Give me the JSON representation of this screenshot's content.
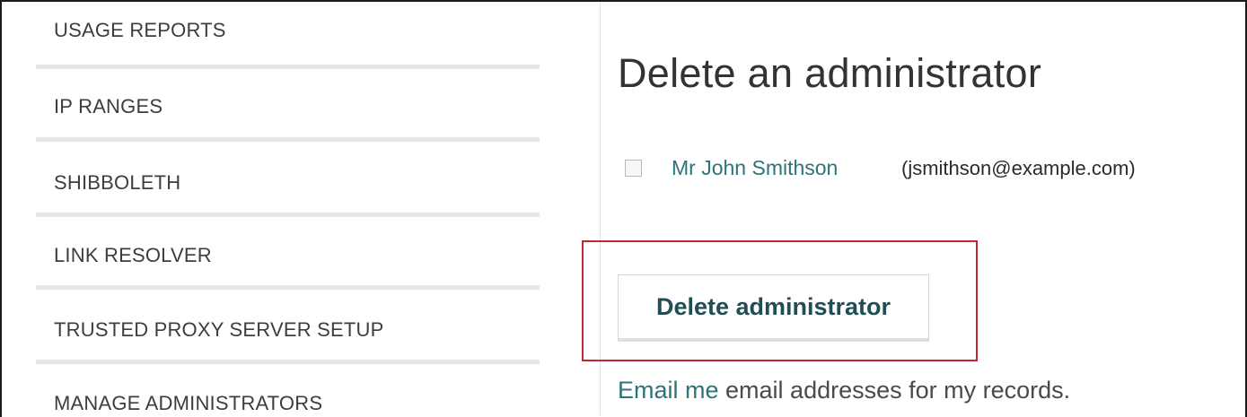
{
  "sidebar": {
    "items": [
      {
        "label": "USAGE REPORTS"
      },
      {
        "label": "IP RANGES"
      },
      {
        "label": "SHIBBOLETH"
      },
      {
        "label": "LINK RESOLVER"
      },
      {
        "label": "TRUSTED PROXY SERVER SETUP"
      },
      {
        "label": "MANAGE ADMINISTRATORS"
      }
    ]
  },
  "main": {
    "title": "Delete an administrator",
    "admins": [
      {
        "name": "Mr John Smithson",
        "email": "(jsmithson@example.com)",
        "checked": false
      }
    ],
    "delete_button_label": "Delete administrator",
    "email_link_text": "Email me",
    "email_rest_text": " email addresses for my records."
  },
  "colors": {
    "accent": "#2c7478",
    "highlight": "#c0282d",
    "text": "#3d3d3d"
  }
}
